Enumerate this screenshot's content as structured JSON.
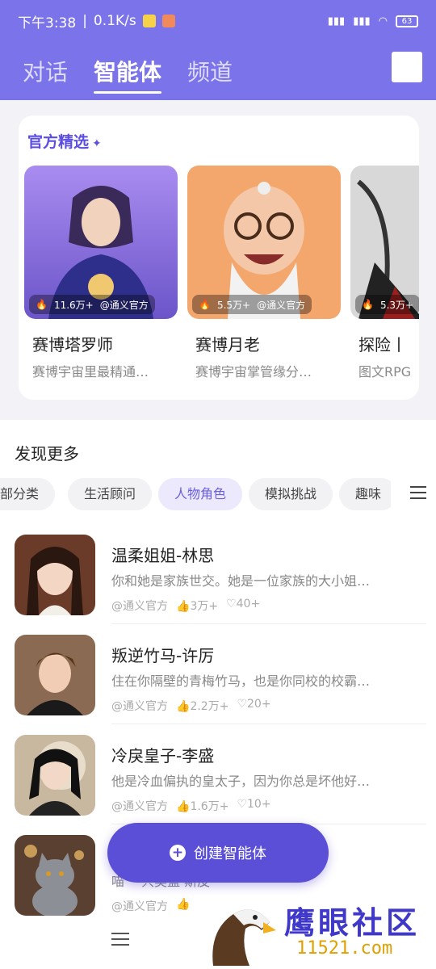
{
  "status_bar": {
    "time": "下午3:38",
    "speed": "0.1K/s",
    "battery": "63"
  },
  "header": {
    "tabs": [
      {
        "label": "对话"
      },
      {
        "label": "智能体"
      },
      {
        "label": "频道"
      }
    ]
  },
  "official": {
    "title": "官方精选",
    "cards": [
      {
        "likes": "11.6万+",
        "author": "@通义官方",
        "name": "赛博塔罗师",
        "desc": "赛博宇宙里最精通…"
      },
      {
        "likes": "5.5万+",
        "author": "@通义官方",
        "name": "赛博月老",
        "desc": "赛博宇宙掌管缘分…"
      },
      {
        "likes": "5.3万+",
        "author": "",
        "name": "探险丨",
        "desc": "图文RPG"
      }
    ]
  },
  "discover": {
    "title": "发现更多",
    "filters": [
      "部分类",
      "生活顾问",
      "人物角色",
      "模拟挑战",
      "趣味"
    ],
    "items": [
      {
        "name": "温柔姐姐-林思",
        "desc": "你和她是家族世交。她是一位家族的大小姐…",
        "author": "@通义官方",
        "likes": "3万+",
        "favorites": "40+"
      },
      {
        "name": "叛逆竹马-许厉",
        "desc": "住在你隔壁的青梅竹马，也是你同校的校霸…",
        "author": "@通义官方",
        "likes": "2.2万+",
        "favorites": "20+"
      },
      {
        "name": "冷戾皇子-李盛",
        "desc": "他是冷血偏执的皇太子，因为你总是坏他好…",
        "author": "@通义官方",
        "likes": "1.6万+",
        "favorites": "10+"
      },
      {
        "name": "",
        "desc": "喵 一只奥蓝 斯皮",
        "author": "@通义官方",
        "likes": "",
        "favorites": ""
      }
    ]
  },
  "fab": {
    "label": "创建智能体"
  },
  "watermark": {
    "text": "鹰眼社区",
    "url": "11521.com"
  }
}
